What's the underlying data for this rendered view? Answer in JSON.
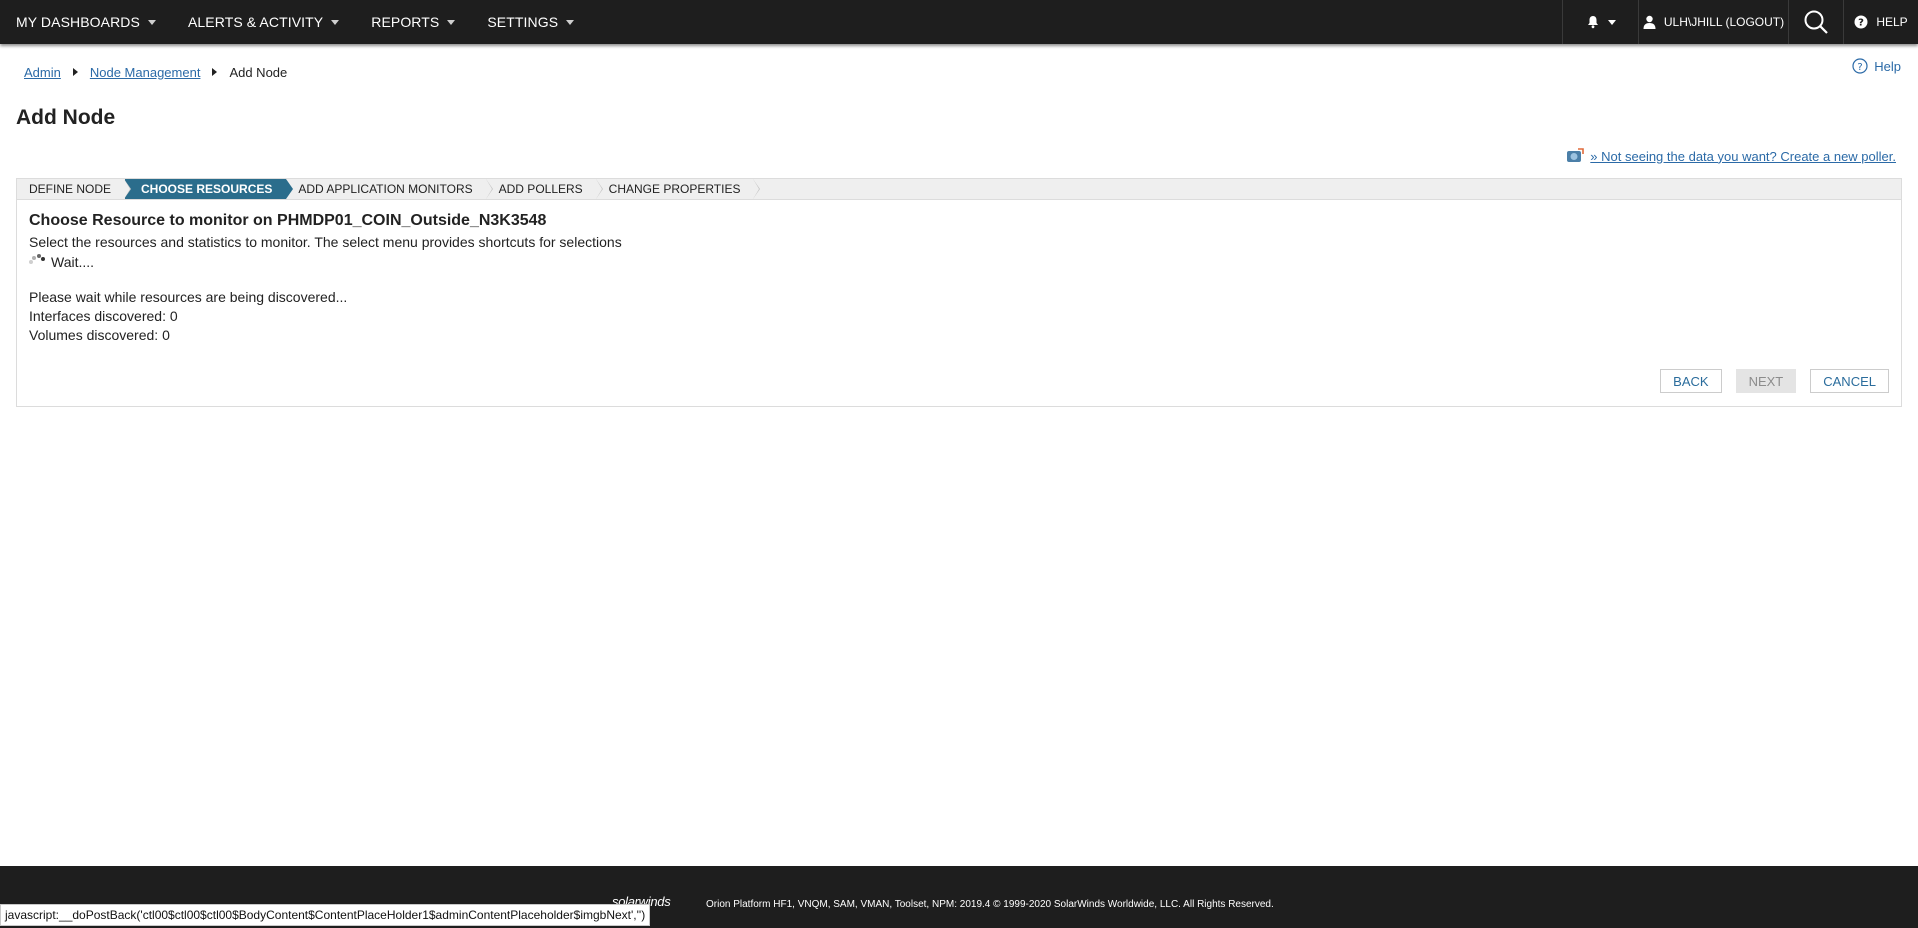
{
  "topnav": {
    "items": [
      {
        "label": "MY DASHBOARDS"
      },
      {
        "label": "ALERTS & ACTIVITY"
      },
      {
        "label": "REPORTS"
      },
      {
        "label": "SETTINGS"
      }
    ],
    "user_label": "ULH\\JHILL (LOGOUT)",
    "help_label": "HELP"
  },
  "breadcrumb": {
    "items": [
      "Admin",
      "Node Management"
    ],
    "current": "Add Node"
  },
  "help_link": "Help",
  "page_title": "Add Node",
  "poller_link": "» Not seeing the data you want? Create a new poller.",
  "wizard": {
    "steps": [
      {
        "label": "DEFINE NODE",
        "active": false
      },
      {
        "label": "CHOOSE RESOURCES",
        "active": true
      },
      {
        "label": "ADD APPLICATION MONITORS",
        "active": false
      },
      {
        "label": "ADD POLLERS",
        "active": false
      },
      {
        "label": "CHANGE PROPERTIES",
        "active": false
      }
    ],
    "heading": "Choose Resource to monitor on PHMDP01_COIN_Outside_N3K3548",
    "instructions": "Select the resources and statistics to monitor. The select menu provides shortcuts for selections",
    "wait_text": "Wait....",
    "discovery_message": "Please wait while resources are being discovered...",
    "interfaces_discovered": "Interfaces discovered: 0",
    "volumes_discovered": "Volumes discovered: 0",
    "buttons": {
      "back": "BACK",
      "next": "NEXT",
      "cancel": "CANCEL"
    }
  },
  "footer": {
    "logo": "solarwinds",
    "copyright": "Orion Platform HF1, VNQM, SAM, VMAN, Toolset, NPM: 2019.4 © 1999-2020 SolarWinds Worldwide, LLC. All Rights Reserved."
  },
  "status_bar": "javascript:__doPostBack('ctl00$ctl00$ctl00$BodyContent$ContentPlaceHolder1$adminContentPlaceholder$imgbNext','')",
  "colors": {
    "nav_bg": "#1e1e1e",
    "active_step": "#2b6d8c",
    "link": "#2b6aa7"
  },
  "icons": [
    "bell-icon",
    "user-icon",
    "search-icon",
    "help-icon",
    "spinner-icon",
    "poller-icon"
  ]
}
